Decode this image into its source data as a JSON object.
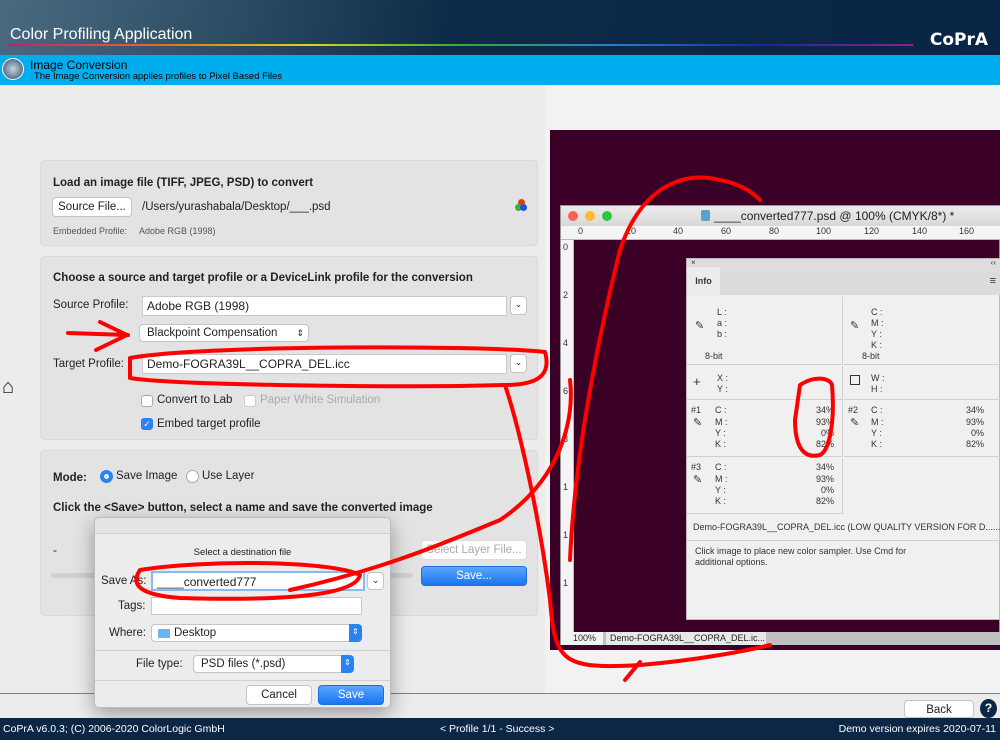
{
  "header": {
    "title": "Color Profiling Application",
    "logo": "CoPrA"
  },
  "subheader": {
    "title": "Image Conversion",
    "subtitle": "The Image Conversion applies profiles to Pixel Based Files"
  },
  "load": {
    "heading": "Load an image file (TIFF, JPEG, PSD) to convert",
    "source_button": "Source File...",
    "path": "/Users/yurashabala/Desktop/___.psd",
    "embedded_label": "Embedded Profile:",
    "embedded_value": "Adobe RGB (1998)"
  },
  "profiles": {
    "heading": "Choose a source and target profile or a DeviceLink profile for the conversion",
    "source_label": "Source Profile:",
    "source_value": "Adobe RGB (1998)",
    "bpc": "Blackpoint Compensation",
    "target_label": "Target Profile:",
    "target_value": "Demo-FOGRA39L__COPRA_DEL.icc",
    "convert_lab": "Convert to Lab",
    "paper_white": "Paper White Simulation",
    "embed": "Embed target profile"
  },
  "mode": {
    "label": "Mode:",
    "save_image": "Save Image",
    "use_layer": "Use Layer",
    "instruction": "Click the <Save> button, select a name and save the converted image",
    "dash": "-",
    "select_layer": "Select Layer File...",
    "save": "Save..."
  },
  "dialog": {
    "title": "Select a destination file",
    "save_as_label": "Save As:",
    "save_as_value": "____converted777",
    "tags_label": "Tags:",
    "where_label": "Where:",
    "where_value": "Desktop",
    "filetype_label": "File type:",
    "filetype_value": "PSD files (*.psd)",
    "cancel": "Cancel",
    "save": "Save"
  },
  "photoshop": {
    "title": "____converted777.psd @ 100% (CMYK/8*) *",
    "ruler": [
      "0",
      "20",
      "40",
      "60",
      "80",
      "100",
      "120",
      "140",
      "160"
    ],
    "vruler": [
      "0",
      "2",
      "4",
      "6",
      "8",
      "1",
      "1",
      "1"
    ],
    "zoom": "100%",
    "status": "Demo-FOGRA39L__COPRA_DEL.ic...",
    "info": {
      "tab": "Info",
      "lab": [
        "L :",
        "a :",
        "b :"
      ],
      "cmyk": [
        "C :",
        "M :",
        "Y :",
        "K :"
      ],
      "bit": "8-bit",
      "xy": [
        "X :",
        "Y :"
      ],
      "wh": [
        "W :",
        "H :"
      ],
      "samplers": [
        {
          "id": "#1",
          "values": [
            "34%",
            "93%",
            "0%",
            "82%"
          ]
        },
        {
          "id": "#2",
          "values": [
            "34%",
            "93%",
            "0%",
            "82%"
          ]
        },
        {
          "id": "#3",
          "values": [
            "34%",
            "93%",
            "0%",
            "82%"
          ]
        }
      ],
      "profile": "Demo-FOGRA39L__COPRA_DEL.icc (LOW QUALITY VERSION FOR D......",
      "hint": "Click image to place new color sampler.  Use Cmd for additional options."
    }
  },
  "footer": {
    "version": "CoPrA v6.0.3; (C) 2006-2020 ColorLogic GmbH",
    "status": "< Profile 1/1 - Success >",
    "demo": "Demo version expires 2020-07-11",
    "back": "Back",
    "help": "?"
  },
  "colors": {
    "accent": "#00adef",
    "annotation": "#ff0000",
    "canvas": "#3a0026"
  }
}
